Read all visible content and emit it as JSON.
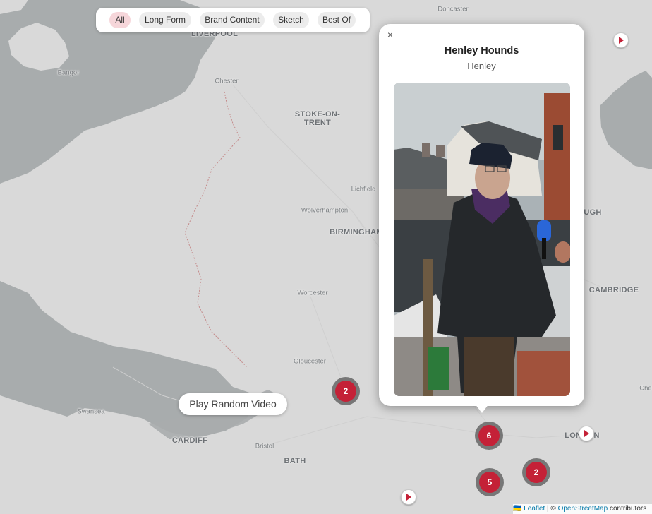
{
  "filters": [
    "All",
    "Long Form",
    "Brand Content",
    "Sketch",
    "Best Of"
  ],
  "active_filter": "All",
  "popup": {
    "title": "Henley Hounds",
    "subtitle": "Henley",
    "close_label": "×"
  },
  "random_button": "Play Random Video",
  "places": [
    {
      "name": "Doncaster",
      "kind": "town"
    },
    {
      "name": "LIVERPOOL",
      "kind": "city"
    },
    {
      "name": "Bangor",
      "kind": "town"
    },
    {
      "name": "Chester",
      "kind": "town"
    },
    {
      "name": "STOKE-ON-",
      "kind": "city"
    },
    {
      "name": "TRENT",
      "kind": "city"
    },
    {
      "name": "Lichfield",
      "kind": "town"
    },
    {
      "name": "Wolverhampton",
      "kind": "town"
    },
    {
      "name": "BIRMINGHAM",
      "kind": "city"
    },
    {
      "name": "Worcester",
      "kind": "town"
    },
    {
      "name": "Gloucester",
      "kind": "town"
    },
    {
      "name": "Swansea",
      "kind": "town"
    },
    {
      "name": "CARDIFF",
      "kind": "city"
    },
    {
      "name": "Bristol",
      "kind": "town"
    },
    {
      "name": "BATH",
      "kind": "city"
    },
    {
      "name": "UGH",
      "kind": "city"
    },
    {
      "name": "CAMBRIDGE",
      "kind": "city"
    },
    {
      "name": "LONDON",
      "kind": "city"
    },
    {
      "name": "Chel",
      "kind": "town"
    }
  ],
  "clusters": [
    {
      "count": "2"
    },
    {
      "count": "6"
    },
    {
      "count": "5"
    },
    {
      "count": "2"
    }
  ],
  "pins": [
    "play-marker",
    "play-marker",
    "play-marker"
  ],
  "attribution": {
    "flag": "🇺🇦",
    "leaflet": "Leaflet",
    "separator": "| ©",
    "osm": "OpenStreetMap",
    "suffix": "contributors"
  },
  "colors": {
    "marker_red": "#c42137",
    "land": "#d9d9d9",
    "sea": "#a8acad",
    "active_chip": "#f6d6da"
  }
}
